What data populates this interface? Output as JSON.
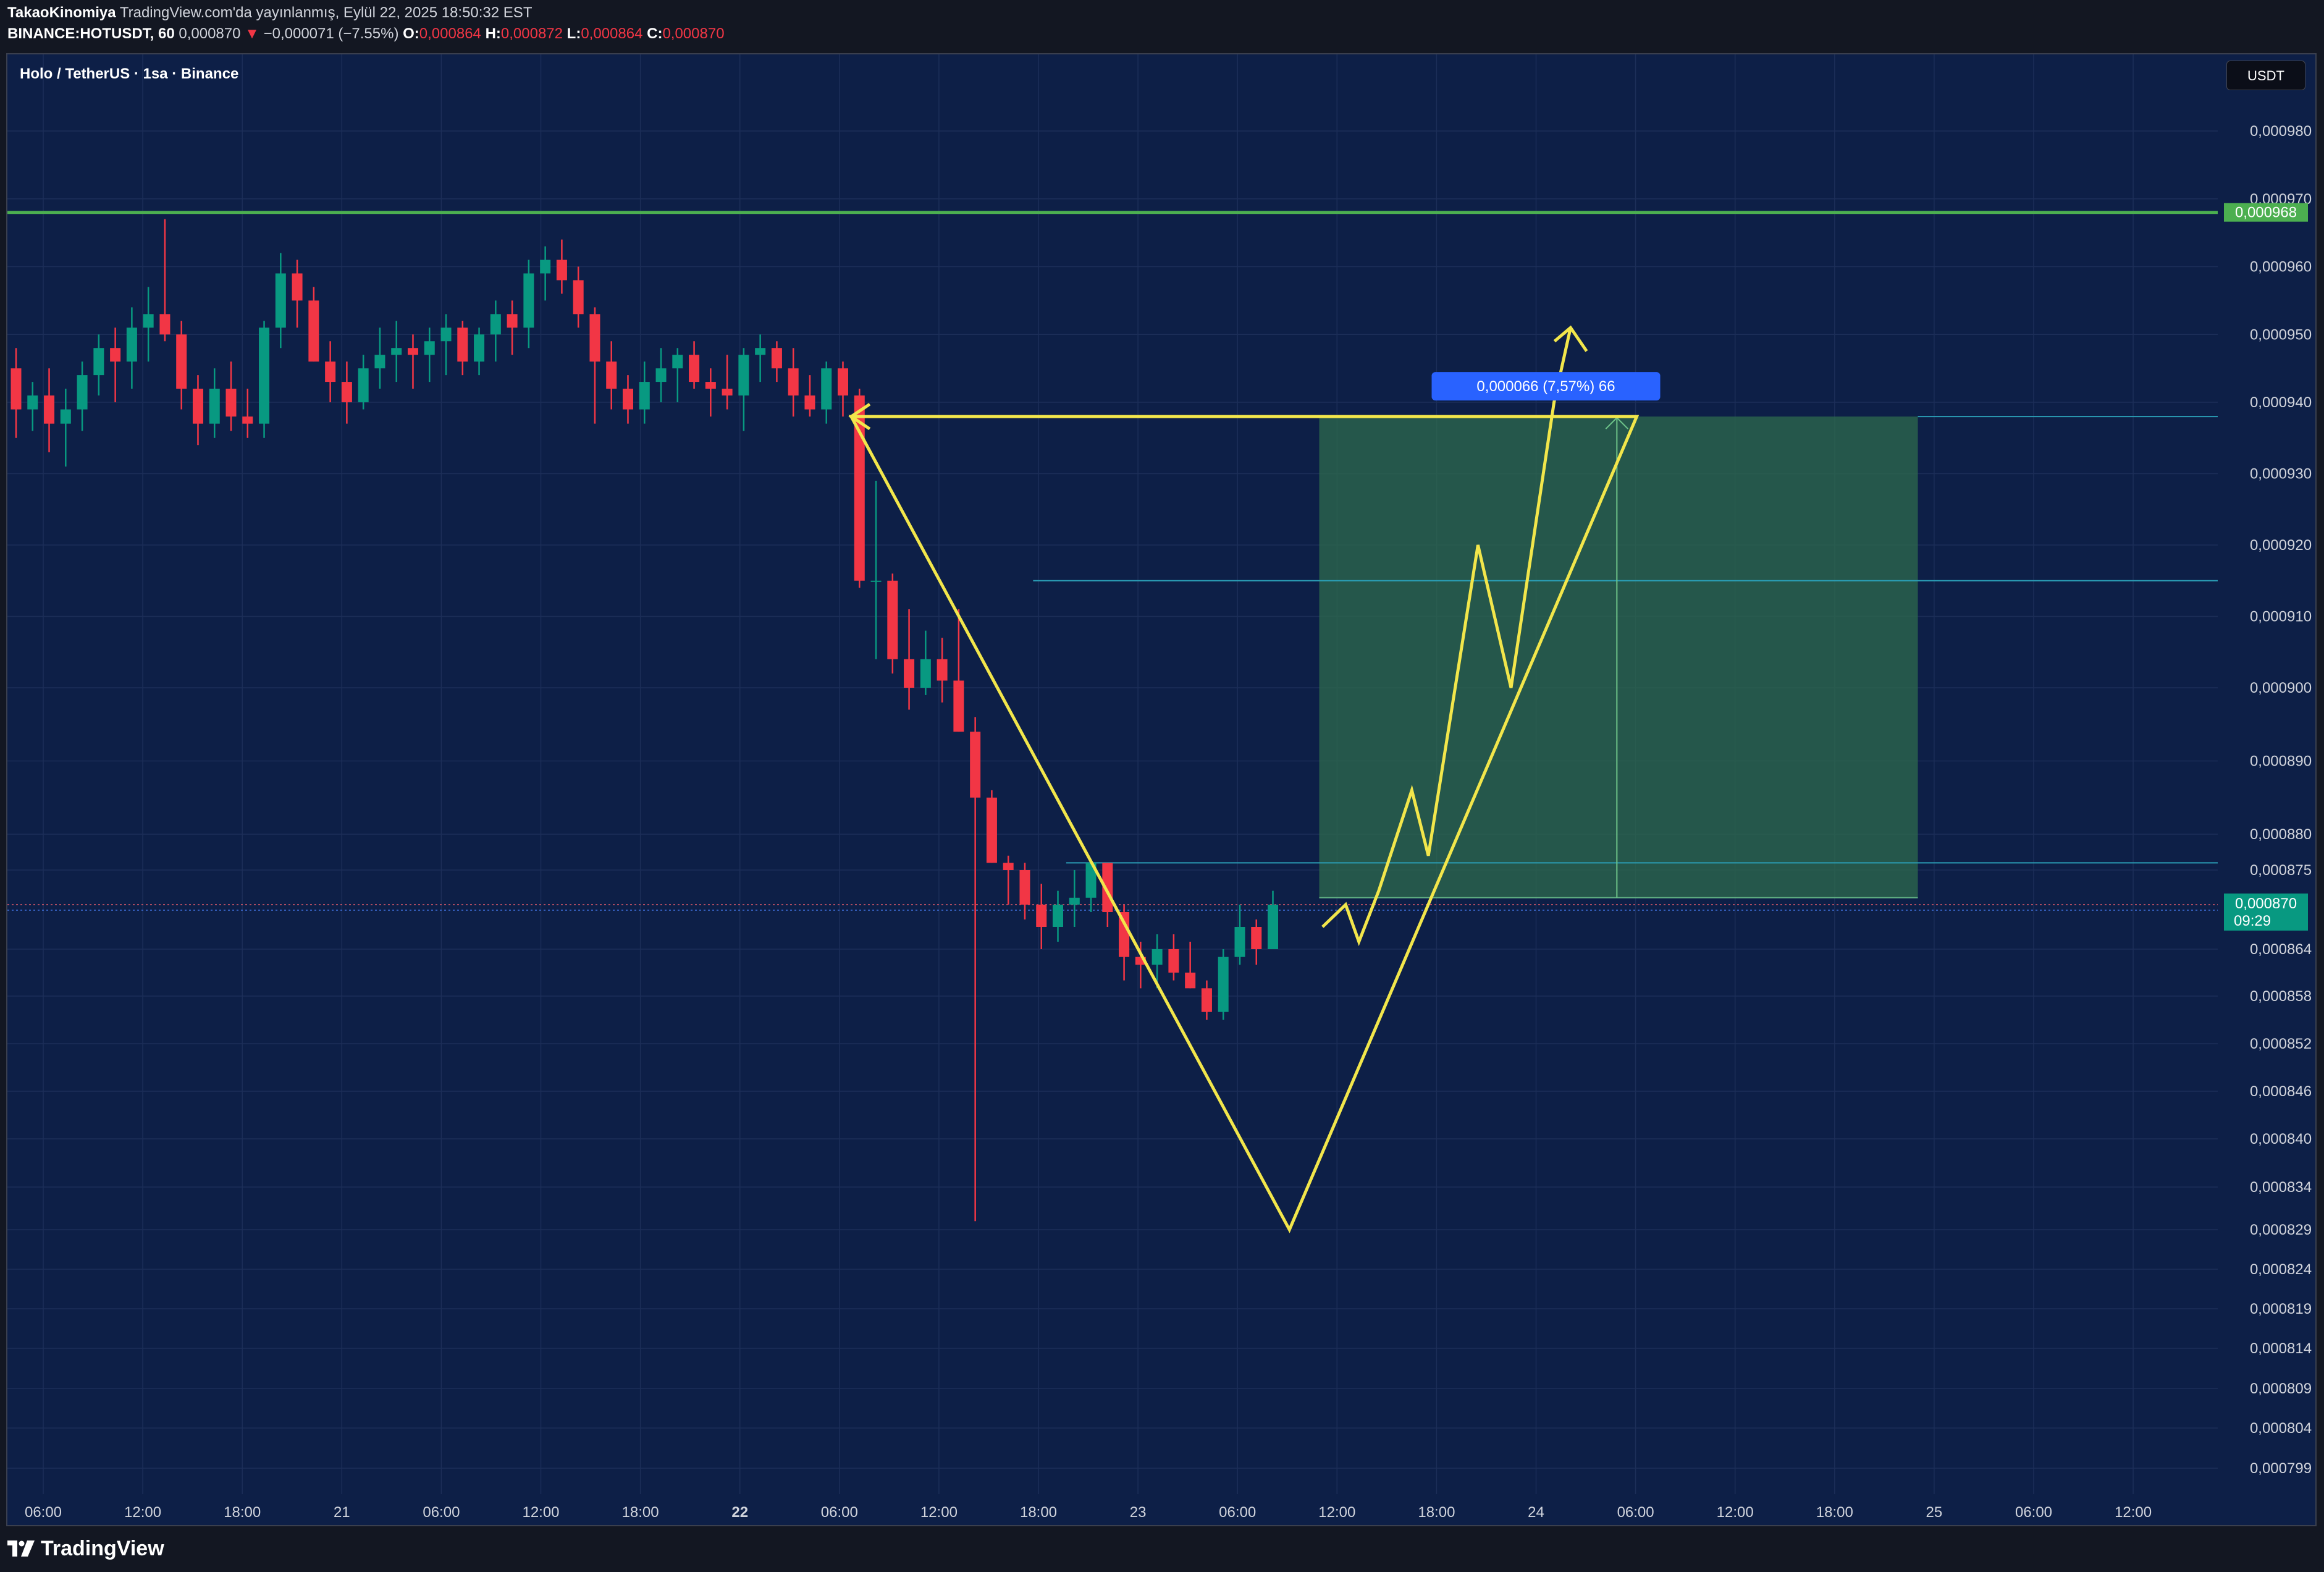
{
  "header": {
    "publisher": "TakaoKinomiya",
    "published_text": "TradingView.com'da yayınlanmış, Eylül 22, 2025 18:50:32 EST",
    "symbol": "BINANCE:HOTUSDT, 60",
    "last": "0,000870",
    "arrow": "▼",
    "change": "−0,000071 (−7.55%)",
    "o_label": "O:",
    "o": "0,000864",
    "h_label": "H:",
    "h": "0,000872",
    "l_label": "L:",
    "l": "0,000864",
    "c_label": "C:",
    "c": "0,000870"
  },
  "chart_title": "Holo / TetherUS · 1sa · Binance",
  "currency": "USDT",
  "footer": {
    "brand": "TradingView"
  },
  "colors": {
    "up": "#089981",
    "down": "#f23645",
    "background": "#0d1f47",
    "drawing_yellow": "#f2e64b",
    "resistance_green": "#4caf50",
    "target_zone": "#2e6b4c",
    "level_lines": "#2a9db5",
    "measure_label": "#2962ff"
  },
  "chart_data": {
    "type": "candlestick",
    "price_scale_labels": [
      "0,000980",
      "0,000970",
      "0,000960",
      "0,000950",
      "0,000940",
      "0,000930",
      "0,000920",
      "0,000910",
      "0,000900",
      "0,000890",
      "0,000880",
      "0,000875",
      "0,000864",
      "0,000858",
      "0,000852",
      "0,000846",
      "0,000840",
      "0,000834",
      "0,000829",
      "0,000824",
      "0,000819",
      "0,000814",
      "0,000809",
      "0,000804",
      "0,000799"
    ],
    "time_labels": [
      "06:00",
      "12:00",
      "18:00",
      "21",
      "06:00",
      "12:00",
      "18:00",
      "22",
      "06:00",
      "12:00",
      "18:00",
      "23",
      "06:00",
      "12:00",
      "18:00",
      "24",
      "06:00",
      "12:00",
      "18:00",
      "25",
      "06:00",
      "12:00"
    ],
    "bold_time_label": "22",
    "ohlc": [
      [
        0.000945,
        0.000948,
        0.000935,
        0.000939
      ],
      [
        0.000939,
        0.000943,
        0.000936,
        0.000941
      ],
      [
        0.000941,
        0.000945,
        0.000933,
        0.000937
      ],
      [
        0.000937,
        0.000942,
        0.000931,
        0.000939
      ],
      [
        0.000939,
        0.000946,
        0.000936,
        0.000944
      ],
      [
        0.000944,
        0.00095,
        0.000941,
        0.000948
      ],
      [
        0.000948,
        0.000951,
        0.00094,
        0.000946
      ],
      [
        0.000946,
        0.000954,
        0.000942,
        0.000951
      ],
      [
        0.000951,
        0.000957,
        0.000946,
        0.000953
      ],
      [
        0.000953,
        0.000967,
        0.000949,
        0.00095
      ],
      [
        0.00095,
        0.000952,
        0.000939,
        0.000942
      ],
      [
        0.000942,
        0.000944,
        0.000934,
        0.000937
      ],
      [
        0.000937,
        0.000945,
        0.000935,
        0.000942
      ],
      [
        0.000942,
        0.000946,
        0.000936,
        0.000938
      ],
      [
        0.000938,
        0.000942,
        0.000935,
        0.000937
      ],
      [
        0.000937,
        0.000952,
        0.000935,
        0.000951
      ],
      [
        0.000951,
        0.000962,
        0.000948,
        0.000959
      ],
      [
        0.000959,
        0.000961,
        0.000951,
        0.000955
      ],
      [
        0.000955,
        0.000957,
        0.000946,
        0.000946
      ],
      [
        0.000946,
        0.000949,
        0.00094,
        0.000943
      ],
      [
        0.000943,
        0.000946,
        0.000937,
        0.00094
      ],
      [
        0.00094,
        0.000947,
        0.000939,
        0.000945
      ],
      [
        0.000945,
        0.000951,
        0.000942,
        0.000947
      ],
      [
        0.000947,
        0.000952,
        0.000943,
        0.000948
      ],
      [
        0.000948,
        0.00095,
        0.000942,
        0.000947
      ],
      [
        0.000947,
        0.000951,
        0.000943,
        0.000949
      ],
      [
        0.000949,
        0.000953,
        0.000944,
        0.000951
      ],
      [
        0.000951,
        0.000952,
        0.000944,
        0.000946
      ],
      [
        0.000946,
        0.000951,
        0.000944,
        0.00095
      ],
      [
        0.00095,
        0.000955,
        0.000946,
        0.000953
      ],
      [
        0.000953,
        0.000955,
        0.000947,
        0.000951
      ],
      [
        0.000951,
        0.000961,
        0.000948,
        0.000959
      ],
      [
        0.000959,
        0.000963,
        0.000955,
        0.000961
      ],
      [
        0.000961,
        0.000964,
        0.000956,
        0.000958
      ],
      [
        0.000958,
        0.00096,
        0.000951,
        0.000953
      ],
      [
        0.000953,
        0.000954,
        0.000937,
        0.000946
      ],
      [
        0.000946,
        0.000949,
        0.000939,
        0.000942
      ],
      [
        0.000942,
        0.000944,
        0.000937,
        0.000939
      ],
      [
        0.000939,
        0.000946,
        0.000937,
        0.000943
      ],
      [
        0.000943,
        0.000948,
        0.00094,
        0.000945
      ],
      [
        0.000945,
        0.000948,
        0.00094,
        0.000947
      ],
      [
        0.000947,
        0.000949,
        0.000942,
        0.000943
      ],
      [
        0.000943,
        0.000945,
        0.000938,
        0.000942
      ],
      [
        0.000942,
        0.000947,
        0.000939,
        0.000941
      ],
      [
        0.000941,
        0.000948,
        0.000936,
        0.000947
      ],
      [
        0.000947,
        0.00095,
        0.000943,
        0.000948
      ],
      [
        0.000948,
        0.000949,
        0.000943,
        0.000945
      ],
      [
        0.000945,
        0.000948,
        0.000938,
        0.000941
      ],
      [
        0.000941,
        0.000944,
        0.000938,
        0.000939
      ],
      [
        0.000939,
        0.000946,
        0.000937,
        0.000945
      ],
      [
        0.000945,
        0.000946,
        0.000938,
        0.000941
      ],
      [
        0.000941,
        0.000942,
        0.000914,
        0.000915
      ],
      [
        0.000915,
        0.000929,
        0.000904,
        0.000915
      ],
      [
        0.000915,
        0.000916,
        0.000902,
        0.000904
      ],
      [
        0.000904,
        0.000911,
        0.000897,
        0.0009
      ],
      [
        0.0009,
        0.000908,
        0.000899,
        0.000904
      ],
      [
        0.000904,
        0.000907,
        0.000898,
        0.000901
      ],
      [
        0.000901,
        0.000911,
        0.000894,
        0.000894
      ],
      [
        0.000894,
        0.000896,
        0.00083,
        0.000885
      ],
      [
        0.000885,
        0.000886,
        0.000876,
        0.000876
      ],
      [
        0.000876,
        0.000877,
        0.00087,
        0.000875
      ],
      [
        0.000875,
        0.000876,
        0.000868,
        0.00087
      ],
      [
        0.00087,
        0.000873,
        0.000864,
        0.000867
      ],
      [
        0.000867,
        0.000872,
        0.000865,
        0.00087
      ],
      [
        0.00087,
        0.000875,
        0.000867,
        0.000871
      ],
      [
        0.000871,
        0.000876,
        0.000869,
        0.000876
      ],
      [
        0.000876,
        0.000876,
        0.000867,
        0.000869
      ],
      [
        0.000869,
        0.00087,
        0.00086,
        0.000863
      ],
      [
        0.000863,
        0.000865,
        0.000859,
        0.000862
      ],
      [
        0.000862,
        0.000866,
        0.000859,
        0.000864
      ],
      [
        0.000864,
        0.000866,
        0.00086,
        0.000861
      ],
      [
        0.000861,
        0.000865,
        0.000859,
        0.000859
      ],
      [
        0.000859,
        0.00086,
        0.000855,
        0.000856
      ],
      [
        0.000856,
        0.000864,
        0.000855,
        0.000863
      ],
      [
        0.000863,
        0.00087,
        0.000862,
        0.000867
      ],
      [
        0.000867,
        0.000868,
        0.000862,
        0.000864
      ],
      [
        0.000864,
        0.000872,
        0.000864,
        0.00087
      ]
    ],
    "levels": {
      "resistance": 0.000968,
      "target": 0.000938,
      "mid_level": 0.000915,
      "support_level": 0.000876,
      "entry": 0.000871,
      "current": 0.00087
    },
    "current_price_label": "0,000870",
    "countdown": "09:29",
    "resistance_label": "0,000968",
    "measurement": {
      "label": "0,000066 (7,57%) 66"
    },
    "drawing_points": {
      "triangle": [
        [
          50.5,
          0.000938
        ],
        [
          77,
          0.000829
        ],
        [
          98,
          0.000938
        ]
      ],
      "path": [
        [
          79,
          0.000867
        ],
        [
          80.4,
          0.00087
        ],
        [
          81.2,
          0.000865
        ],
        [
          82.4,
          0.000872
        ],
        [
          84.4,
          0.000886
        ],
        [
          85.4,
          0.000877
        ],
        [
          88.4,
          0.00092
        ],
        [
          90.4,
          0.0009
        ],
        [
          93,
          0.00094
        ],
        [
          94,
          0.000951
        ]
      ]
    }
  }
}
